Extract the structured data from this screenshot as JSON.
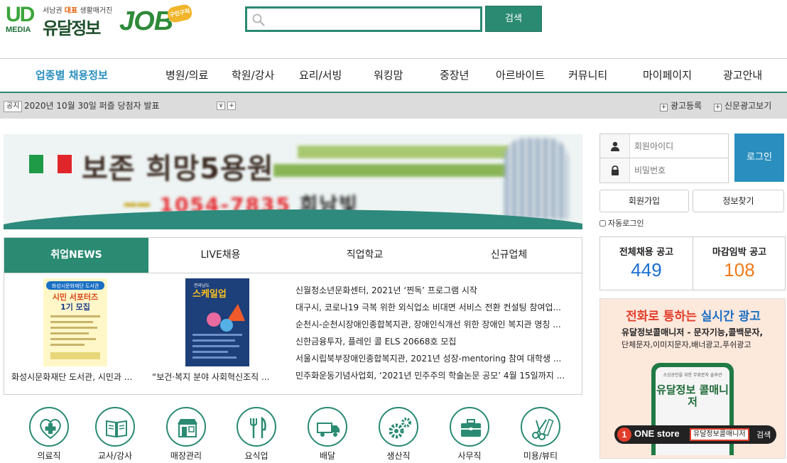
{
  "logo": {
    "ud": "UD",
    "media": "MEDIA",
    "tagline_prefix": "서남권",
    "tagline_strong": "대표",
    "tagline_suffix": "생활매거진",
    "brand": "유달정보",
    "job": "JOB",
    "badge": "구인구직"
  },
  "search": {
    "value": "",
    "placeholder": "",
    "button_label": "검색"
  },
  "nav": {
    "items": [
      "업종별 채용정보",
      "병원/의료",
      "학원/강사",
      "요리/서빙",
      "워킹맘",
      "중장년",
      "아르바이트",
      "커뮤니티",
      "마이페이지",
      "광고안내"
    ]
  },
  "notice": {
    "tag": "공지",
    "text": "2020년 10월 30일 퍼즐 당첨자 발표",
    "prev": "∨",
    "next": "+",
    "link1": "광고등록",
    "link2": "신문광고보기",
    "plus": "+"
  },
  "banner": {
    "title": "보존 희망5용원",
    "sub_a": "━━",
    "sub_b": "1054-7835",
    "sub_c": "희남빛"
  },
  "news": {
    "tabs": [
      "취업NEWS",
      "LIVE채용",
      "직업학교",
      "신규업체"
    ],
    "poster1": {
      "top": "화성시문화재단 도서관",
      "title1": "시민 서포터즈",
      "title2": "1기 모집"
    },
    "poster2": {
      "top": "전라남도",
      "title": "스케일업"
    },
    "captions": [
      "화성시문화재단 도서관, 시민과 ...",
      "“보건·복지 분야 사회혁신조직 ..."
    ],
    "list": [
      "신월청소년문화센터, 2021년 ‘찐독’ 프로그램 시작",
      "대구시, 코로나19 극복 위한 외식업소 비대면 서비스 전환 컨설팅 참여업...",
      "순천시-순천시장애인종합복지관, 장애인식개선 위한 장애인 복지관 명칭 ...",
      "신한금융투자, 플레인 콜 ELS 20668호 모집",
      "서울시립북부장애인종합복지관, 2021년 성장-mentoring 참여 대학생 ...",
      "민주화운동기념사업회, ‘2021년 민주주의 학술논문 공모’ 4월 15일까지 ..."
    ]
  },
  "categories": [
    "의료직",
    "교사/강사",
    "매장관리",
    "요식업",
    "배달",
    "생산직",
    "사무직",
    "미용/뷰티"
  ],
  "login": {
    "id_placeholder": "회원아이디",
    "pw_placeholder": "비밀번호",
    "login_label": "로그인",
    "join_label": "회원가입",
    "find_label": "정보찾기",
    "auto_label": "자동로그인"
  },
  "stats": {
    "total_label": "전체채용 공고",
    "total_value": "449",
    "deadline_label": "마감임박 공고",
    "deadline_value": "108"
  },
  "ad": {
    "h1_a": "전화로 통하는 ",
    "h1_b": "실시간 광고",
    "h2": "유달정보콜매니저 - 문자기능,콜백문자,",
    "h3": "단체문자,이미지문자,배너광고,푸쉬광고",
    "phone_small": "소상공인을 위한 무료문자 솔루션",
    "phone_title": "유달정보 콜매니저",
    "one": "1",
    "store": "ONE store",
    "store_name": "유달정보콜매니저",
    "store_search": "검색"
  },
  "colors": {
    "accent": "#2a8a72",
    "blue": "#2a8fbf",
    "orange": "#f07a1a",
    "total_num": "#1a6fd0"
  }
}
